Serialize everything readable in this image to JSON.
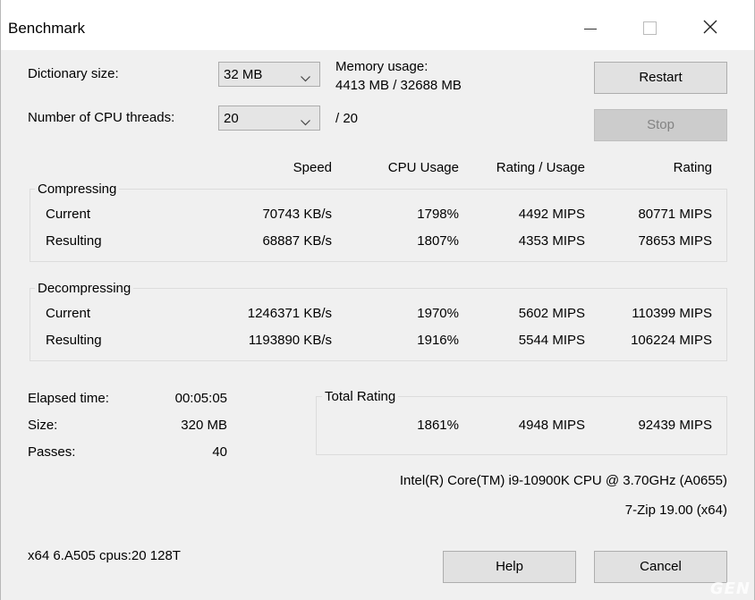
{
  "window": {
    "title": "Benchmark"
  },
  "settings": {
    "dictionary_label": "Dictionary size:",
    "dictionary_value": "32 MB",
    "memory_label": "Memory usage:",
    "memory_value": "4413 MB / 32688 MB",
    "threads_label": "Number of CPU threads:",
    "threads_value": "20",
    "threads_total": "/ 20"
  },
  "buttons": {
    "restart": "Restart",
    "stop": "Stop",
    "help": "Help",
    "cancel": "Cancel"
  },
  "columns": {
    "speed": "Speed",
    "cpu_usage": "CPU Usage",
    "rating_usage": "Rating / Usage",
    "rating": "Rating"
  },
  "compressing": {
    "title": "Compressing",
    "rows": [
      {
        "label": "Current",
        "speed": "70743 KB/s",
        "cpu": "1798%",
        "rating_usage": "4492 MIPS",
        "rating": "80771 MIPS"
      },
      {
        "label": "Resulting",
        "speed": "68887 KB/s",
        "cpu": "1807%",
        "rating_usage": "4353 MIPS",
        "rating": "78653 MIPS"
      }
    ]
  },
  "decompressing": {
    "title": "Decompressing",
    "rows": [
      {
        "label": "Current",
        "speed": "1246371 KB/s",
        "cpu": "1970%",
        "rating_usage": "5602 MIPS",
        "rating": "110399 MIPS"
      },
      {
        "label": "Resulting",
        "speed": "1193890 KB/s",
        "cpu": "1916%",
        "rating_usage": "5544 MIPS",
        "rating": "106224 MIPS"
      }
    ]
  },
  "stats": {
    "elapsed_label": "Elapsed time:",
    "elapsed_value": "00:05:05",
    "size_label": "Size:",
    "size_value": "320 MB",
    "passes_label": "Passes:",
    "passes_value": "40"
  },
  "total": {
    "title": "Total Rating",
    "cpu": "1861%",
    "rating_usage": "4948 MIPS",
    "rating": "92439 MIPS"
  },
  "system": {
    "cpu_name": "Intel(R) Core(TM) i9-10900K CPU @ 3.70GHz (A0655)",
    "version": "7-Zip 19.00 (x64)",
    "build_info": "x64 6.A505 cpus:20 128T"
  },
  "watermark": "GEN",
  "icons": [
    "minimize-icon",
    "maximize-icon",
    "close-icon",
    "chevron-down-icon"
  ]
}
